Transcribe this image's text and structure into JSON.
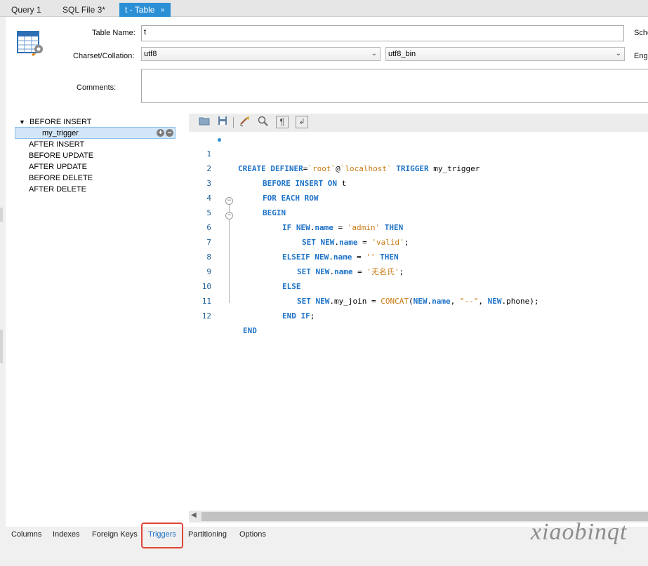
{
  "tabs": [
    {
      "label": "Query 1"
    },
    {
      "label": "SQL File 3*"
    },
    {
      "label": "t - Table",
      "close": "×"
    }
  ],
  "form": {
    "table_name_label": "Table Name:",
    "table_name_value": "t",
    "schema_label": "Sche",
    "charset_label": "Charset/Collation:",
    "charset_value": "utf8",
    "collation_value": "utf8_bin",
    "engine_label": "Engi",
    "comments_label": "Comments:",
    "comments_value": ""
  },
  "trigger_tree": {
    "expanded_group": "BEFORE INSERT",
    "selected_trigger": "my_trigger",
    "groups": [
      "AFTER INSERT",
      "BEFORE UPDATE",
      "AFTER UPDATE",
      "BEFORE DELETE",
      "AFTER DELETE"
    ]
  },
  "editor": {
    "line_numbers": [
      "1",
      "2",
      "3",
      "4",
      "5",
      "6",
      "7",
      "8",
      "9",
      "10",
      "11",
      "12"
    ],
    "toolbar_icons": [
      "open-folder-icon",
      "save-icon",
      "beautify-icon",
      "find-icon",
      "invisible-chars-icon",
      "wrap-icon"
    ]
  },
  "bottom_tabs": [
    {
      "label": "Columns"
    },
    {
      "label": "Indexes"
    },
    {
      "label": "Foreign Keys"
    },
    {
      "label": "Triggers"
    },
    {
      "label": "Partitioning"
    },
    {
      "label": "Options"
    }
  ],
  "watermark": "xiaobinqt",
  "colors": {
    "accent": "#2b8fd6",
    "keyword": "#1e73c8",
    "string": "#c87c14",
    "highlight": "#e0443a"
  }
}
